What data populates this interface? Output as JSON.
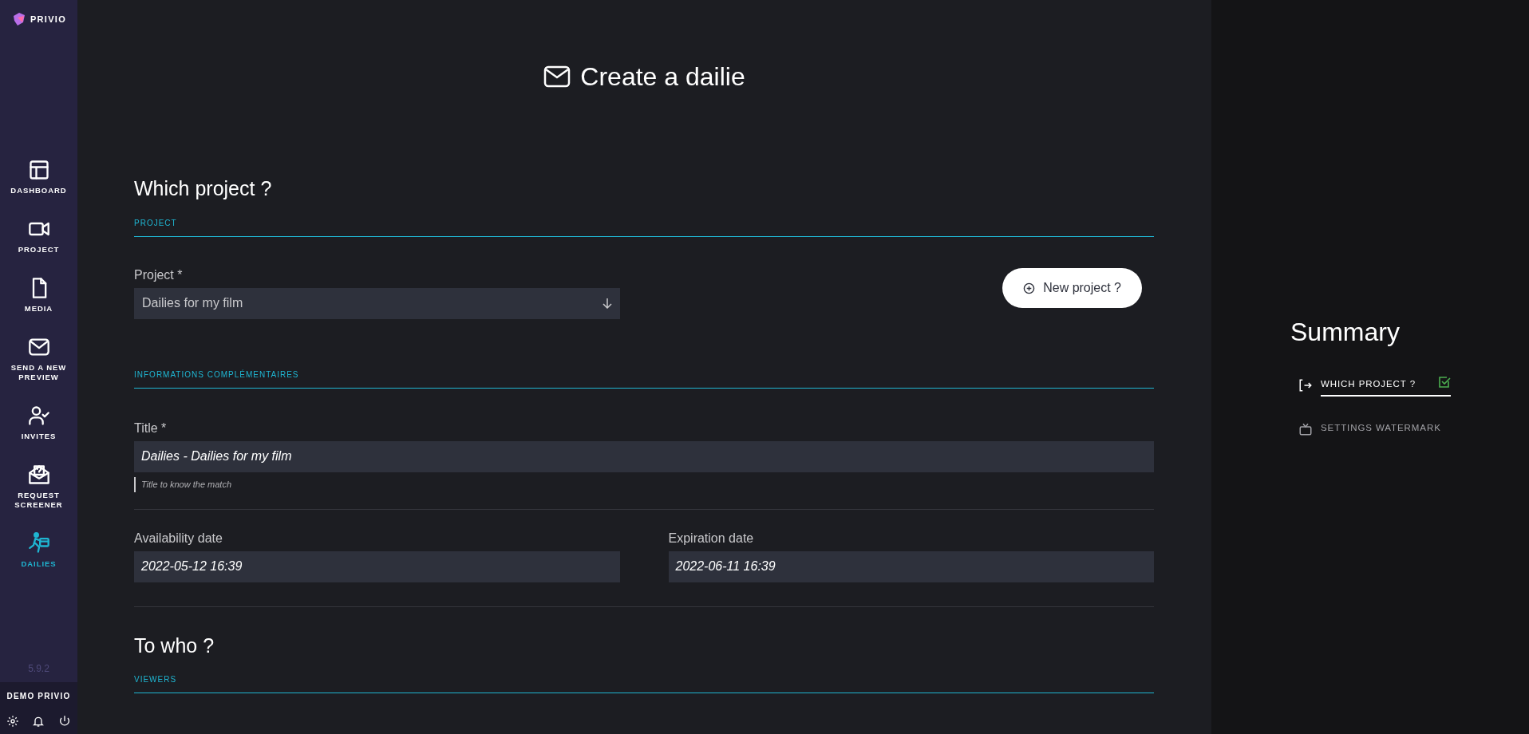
{
  "brand": {
    "name": "PRIVIO"
  },
  "sidebar": {
    "items": [
      {
        "kind": "dashboard",
        "label": "DASHBOARD",
        "selected": false
      },
      {
        "kind": "project",
        "label": "PROJECT",
        "selected": false
      },
      {
        "kind": "media",
        "label": "MEDIA",
        "selected": false
      },
      {
        "kind": "send",
        "label": "SEND A NEW PREVIEW",
        "selected": false
      },
      {
        "kind": "invites",
        "label": "INVITES",
        "selected": false
      },
      {
        "kind": "request",
        "label": "REQUEST SCREENER",
        "selected": false
      },
      {
        "kind": "dailies",
        "label": "DAILIES",
        "selected": true
      }
    ],
    "version": "5.9.2",
    "account": "DEMO PRIVIO"
  },
  "page_title": "Create a dailie",
  "sections": [
    {
      "title": "Which project ?",
      "groups": [
        {
          "label": "PROJECT",
          "kind": "project_select",
          "field": {
            "label": "Project *",
            "value": "Dailies for my film"
          },
          "button": "New project ?"
        },
        {
          "label": "INFORMATIONS COMPLÉMENTAIRES",
          "kind": "info",
          "title_field": {
            "label": "Title *",
            "value": "Dailies - Dailies for my film",
            "hint": "Title to know the match"
          },
          "dates": [
            {
              "label": "Availability date",
              "value": "2022-05-12 16:39"
            },
            {
              "label": "Expiration date",
              "value": "2022-06-11 16:39"
            }
          ]
        }
      ]
    },
    {
      "title": "To who ?",
      "groups": [
        {
          "label": "VIEWERS",
          "kind": "viewers"
        }
      ]
    }
  ],
  "summary": {
    "title": "Summary",
    "items": [
      {
        "kind": "enter",
        "label": "WHICH PROJECT ?",
        "selected": true,
        "done": true
      },
      {
        "kind": "tv",
        "label": "SETTINGS WATERMARK",
        "selected": false,
        "done": false
      }
    ]
  }
}
